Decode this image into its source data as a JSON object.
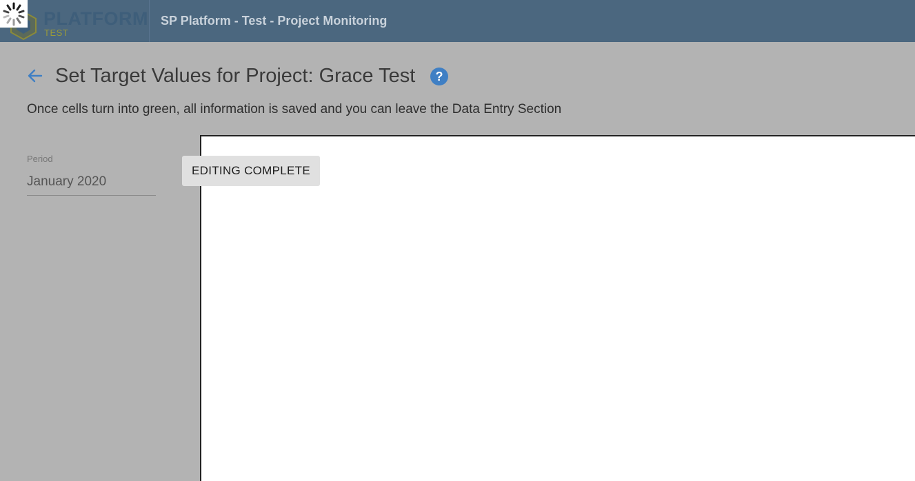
{
  "header": {
    "logo_text": "PLATFORM",
    "logo_sub": "TEST",
    "app_title": "SP Platform - Test - Project Monitoring"
  },
  "page": {
    "title": "Set Target Values for Project: Grace Test",
    "subtitle": "Once cells turn into green, all information is saved and you can leave the Data Entry Section"
  },
  "period": {
    "label": "Period",
    "value": "January 2020"
  },
  "actions": {
    "editing_complete": "EDITING COMPLETE"
  },
  "colors": {
    "topbar": "#4b677f",
    "accent": "#3f7fc4",
    "overlay": "#b3b3b3"
  },
  "icons": {
    "back": "arrow-left-icon",
    "help": "question-circle-icon",
    "loading": "spinner-icon",
    "logo": "hexagon-logo-icon"
  }
}
